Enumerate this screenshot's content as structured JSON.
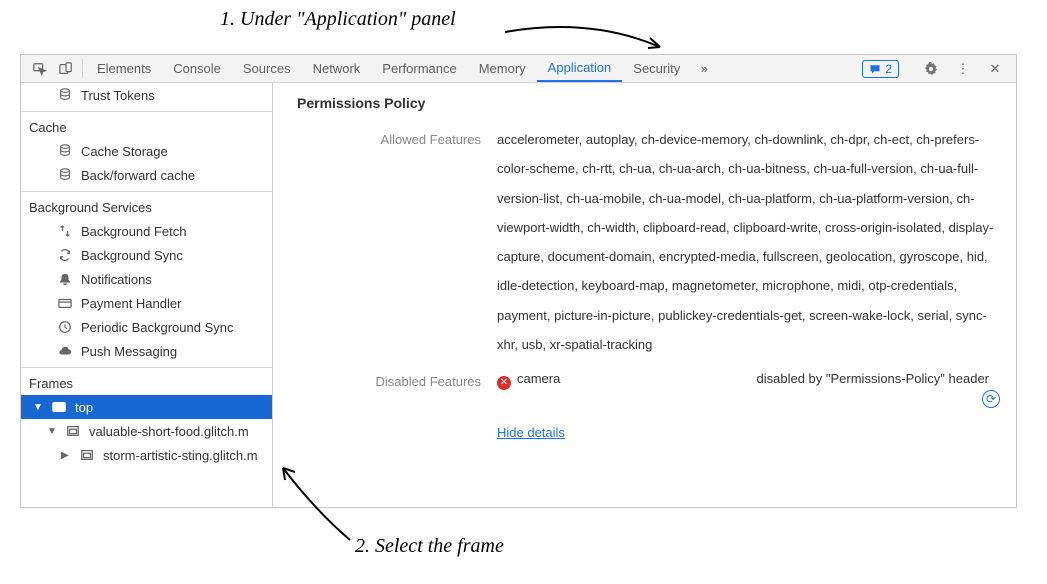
{
  "annotations": {
    "a1": "1. Under \"Application\" panel",
    "a2": "2. Select the frame"
  },
  "toolbar": {
    "tabs": [
      "Elements",
      "Console",
      "Sources",
      "Network",
      "Performance",
      "Memory",
      "Application",
      "Security"
    ],
    "active_index": 6,
    "messages_badge": "2"
  },
  "sidebar": {
    "items": [
      {
        "label": "Trust Tokens",
        "icon": "database",
        "indent": true
      },
      {
        "divider": true
      },
      {
        "label": "Cache",
        "header": true
      },
      {
        "label": "Cache Storage",
        "icon": "database",
        "indent": true
      },
      {
        "label": "Back/forward cache",
        "icon": "database",
        "indent": true
      },
      {
        "divider": true
      },
      {
        "label": "Background Services",
        "header": true
      },
      {
        "label": "Background Fetch",
        "icon": "fetch",
        "indent": true
      },
      {
        "label": "Background Sync",
        "icon": "sync",
        "indent": true
      },
      {
        "label": "Notifications",
        "icon": "bell",
        "indent": true
      },
      {
        "label": "Payment Handler",
        "icon": "card",
        "indent": true
      },
      {
        "label": "Periodic Background Sync",
        "icon": "clock",
        "indent": true
      },
      {
        "label": "Push Messaging",
        "icon": "cloud",
        "indent": true
      },
      {
        "divider": true
      },
      {
        "label": "Frames",
        "header": true
      }
    ],
    "frames": {
      "top": "top",
      "child1": "valuable-short-food.glitch.m",
      "child2": "storm-artistic-sting.glitch.m"
    }
  },
  "main": {
    "title": "Permissions Policy",
    "allowed_label": "Allowed Features",
    "allowed_value": "accelerometer, autoplay, ch-device-memory, ch-downlink, ch-dpr, ch-ect, ch-prefers-color-scheme, ch-rtt, ch-ua, ch-ua-arch, ch-ua-bitness, ch-ua-full-version, ch-ua-full-version-list, ch-ua-mobile, ch-ua-model, ch-ua-platform, ch-ua-platform-version, ch-viewport-width, ch-width, clipboard-read, clipboard-write, cross-origin-isolated, display-capture, document-domain, encrypted-media, fullscreen, geolocation, gyroscope, hid, idle-detection, keyboard-map, magnetometer, microphone, midi, otp-credentials, payment, picture-in-picture, publickey-credentials-get, screen-wake-lock, serial, sync-xhr, usb, xr-spatial-tracking",
    "disabled_label": "Disabled Features",
    "disabled_feature": "camera",
    "disabled_reason": "disabled by \"Permissions-Policy\" header",
    "hide_details": "Hide details"
  }
}
